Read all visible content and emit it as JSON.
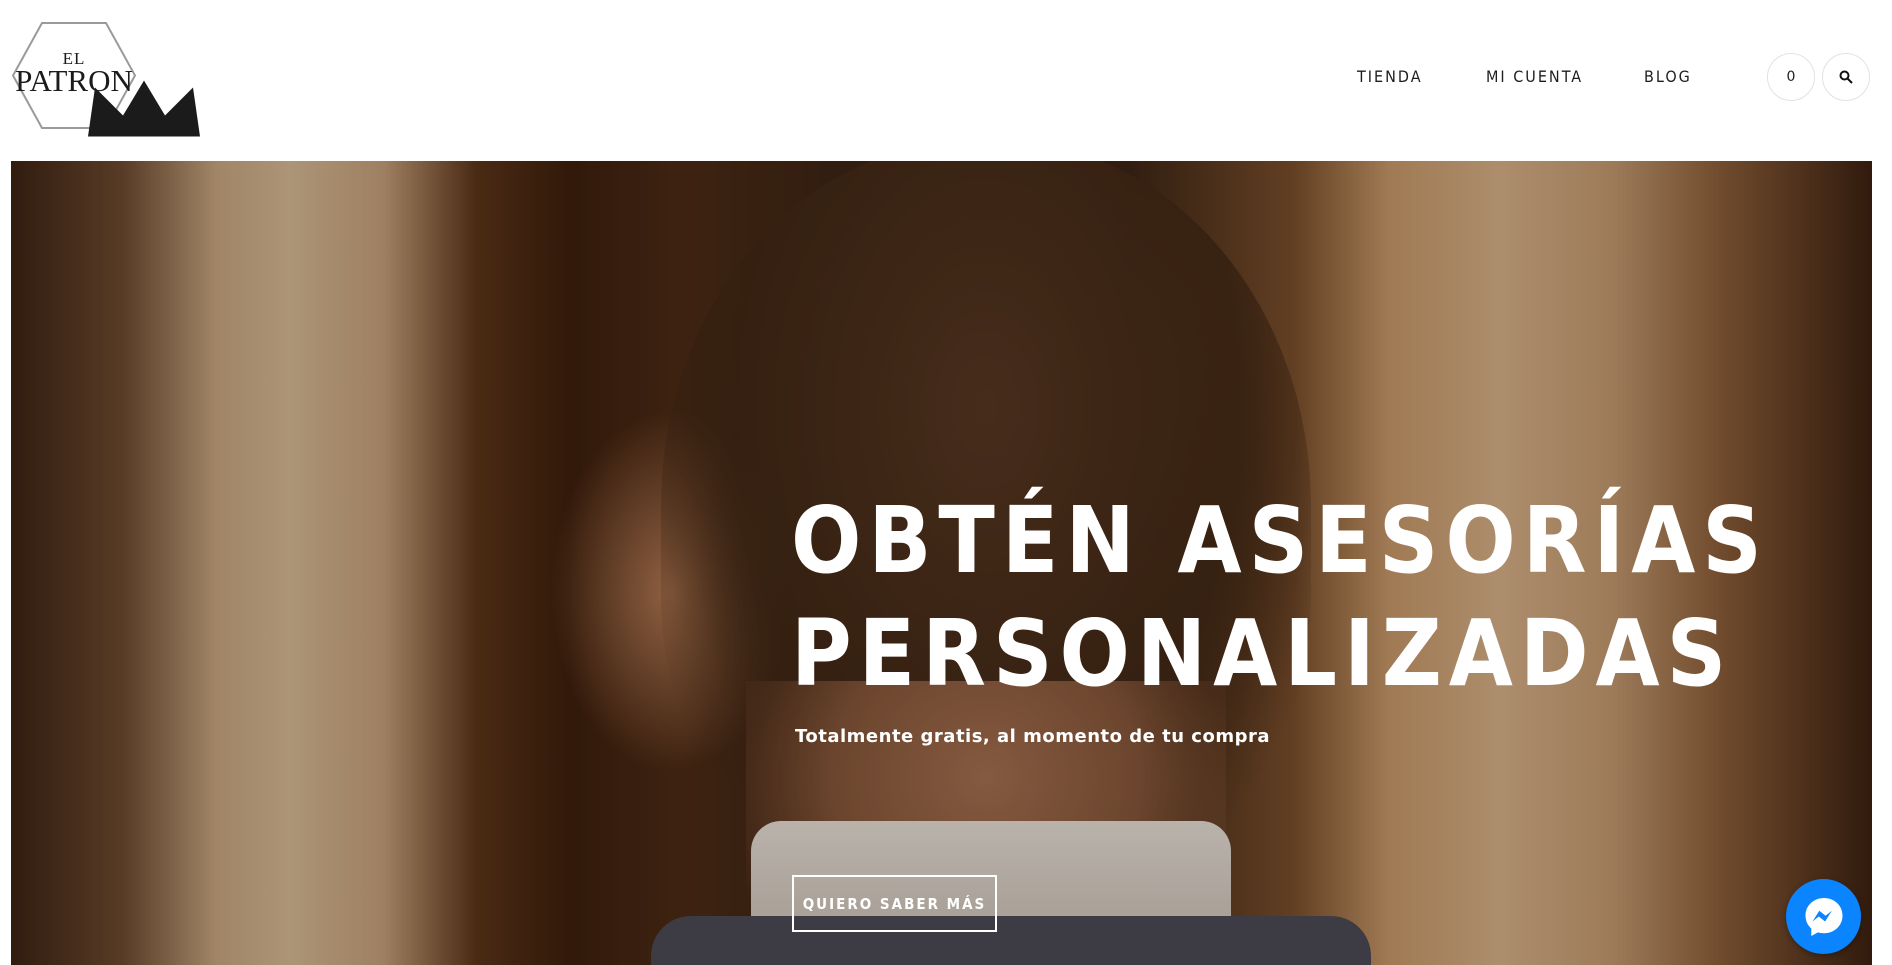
{
  "logo": {
    "line1": "EL",
    "line2": "PATRON"
  },
  "nav": {
    "items": [
      {
        "label": "TIENDA"
      },
      {
        "label": "MI CUENTA"
      },
      {
        "label": "BLOG"
      }
    ],
    "cart_count": "0",
    "icons": {
      "cart": "cart-count-icon",
      "search": "search-icon"
    }
  },
  "hero": {
    "title_line1": "OBTÉN ASESORÍAS",
    "title_line2": "PERSONALIZADAS",
    "subtitle": "Totalmente gratis, al momento de tu compra",
    "cta_label": "QUIERO SABER MÁS"
  },
  "chat": {
    "icon": "messenger-icon",
    "color": "#0a84ff"
  }
}
